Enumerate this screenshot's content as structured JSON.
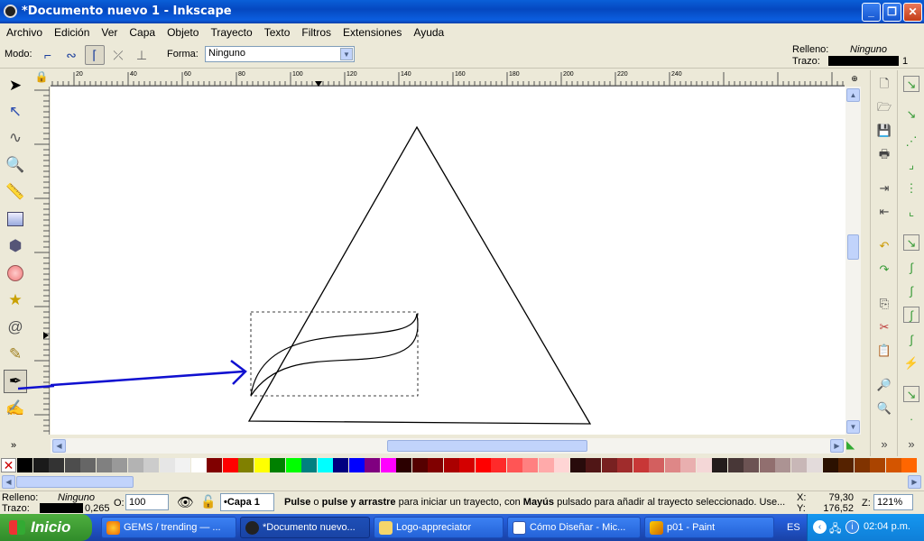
{
  "window": {
    "title": "*Documento nuevo 1 - Inkscape",
    "buttons": {
      "minimize": "_",
      "maximize": "❐",
      "close": "✕"
    }
  },
  "menu": [
    "Archivo",
    "Edición",
    "Ver",
    "Capa",
    "Objeto",
    "Trayecto",
    "Texto",
    "Filtros",
    "Extensiones",
    "Ayuda"
  ],
  "controls": {
    "mode_label": "Modo:",
    "shape_label": "Forma:",
    "shape_value": "Ninguno",
    "fill_label": "Relleno:",
    "fill_value": "Ninguno",
    "stroke_label": "Trazo:",
    "stroke_width": "1"
  },
  "ruler": {
    "top_ticks": [
      "20",
      "40",
      "60",
      "80",
      "100",
      "120",
      "140",
      "160",
      "180",
      "200",
      "220",
      "240"
    ],
    "left_ticks": [
      "1",
      "1",
      "1",
      "1",
      "1",
      "8",
      "6",
      "4",
      "2",
      "0",
      "8",
      "6",
      "4",
      "2"
    ]
  },
  "status": {
    "fill_label": "Relleno:",
    "fill_value": "Ninguno",
    "stroke_label": "Trazo:",
    "stroke_value": "0,265",
    "opacity_label": "O:",
    "opacity_value": "100",
    "layer": "•Capa 1",
    "msg_b1": "Pulse",
    "msg_t1": " o ",
    "msg_b2": "pulse y arrastre",
    "msg_t2": " para iniciar un trayecto, con ",
    "msg_b3": "Mayús",
    "msg_t3": " pulsado para añadir al trayecto seleccionado. Use...",
    "x_label": "X:",
    "x_value": "79,30",
    "y_label": "Y:",
    "y_value": "176,52",
    "zoom_label": "Z:",
    "zoom_value": "121%"
  },
  "taskbar": {
    "start": "Inicio",
    "tasks": [
      "GEMS / trending — ...",
      "*Documento nuevo...",
      "Logo-appreciator",
      "Cómo Diseñar - Mic...",
      "p01 - Paint"
    ],
    "lang": "ES",
    "clock": "02:04 p.m."
  },
  "colors": {
    "palette": [
      "#000000",
      "#1a1a1a",
      "#333333",
      "#4d4d4d",
      "#666666",
      "#808080",
      "#999999",
      "#b3b3b3",
      "#cccccc",
      "#e6e6e6",
      "#f2f2f2",
      "#ffffff",
      "#800000",
      "#ff0000",
      "#808000",
      "#ffff00",
      "#008000",
      "#00ff00",
      "#008080",
      "#00ffff",
      "#000080",
      "#0000ff",
      "#800080",
      "#ff00ff",
      "#2b0000",
      "#550000",
      "#800000",
      "#aa0000",
      "#d40000",
      "#ff0000",
      "#ff2a2a",
      "#ff5555",
      "#ff8080",
      "#ffaaaa",
      "#ffd5d5",
      "#280b0b",
      "#501616",
      "#782121",
      "#a02c2c",
      "#c83737",
      "#d35f5f",
      "#de8787",
      "#e9afaf",
      "#f4d7d7",
      "#241c1c",
      "#483737",
      "#6c5353",
      "#916f6f",
      "#ac9393",
      "#c8b7b7",
      "#e3dbdb",
      "#2b1100",
      "#552200",
      "#803300",
      "#aa4400",
      "#d45500",
      "#ff6600"
    ]
  }
}
